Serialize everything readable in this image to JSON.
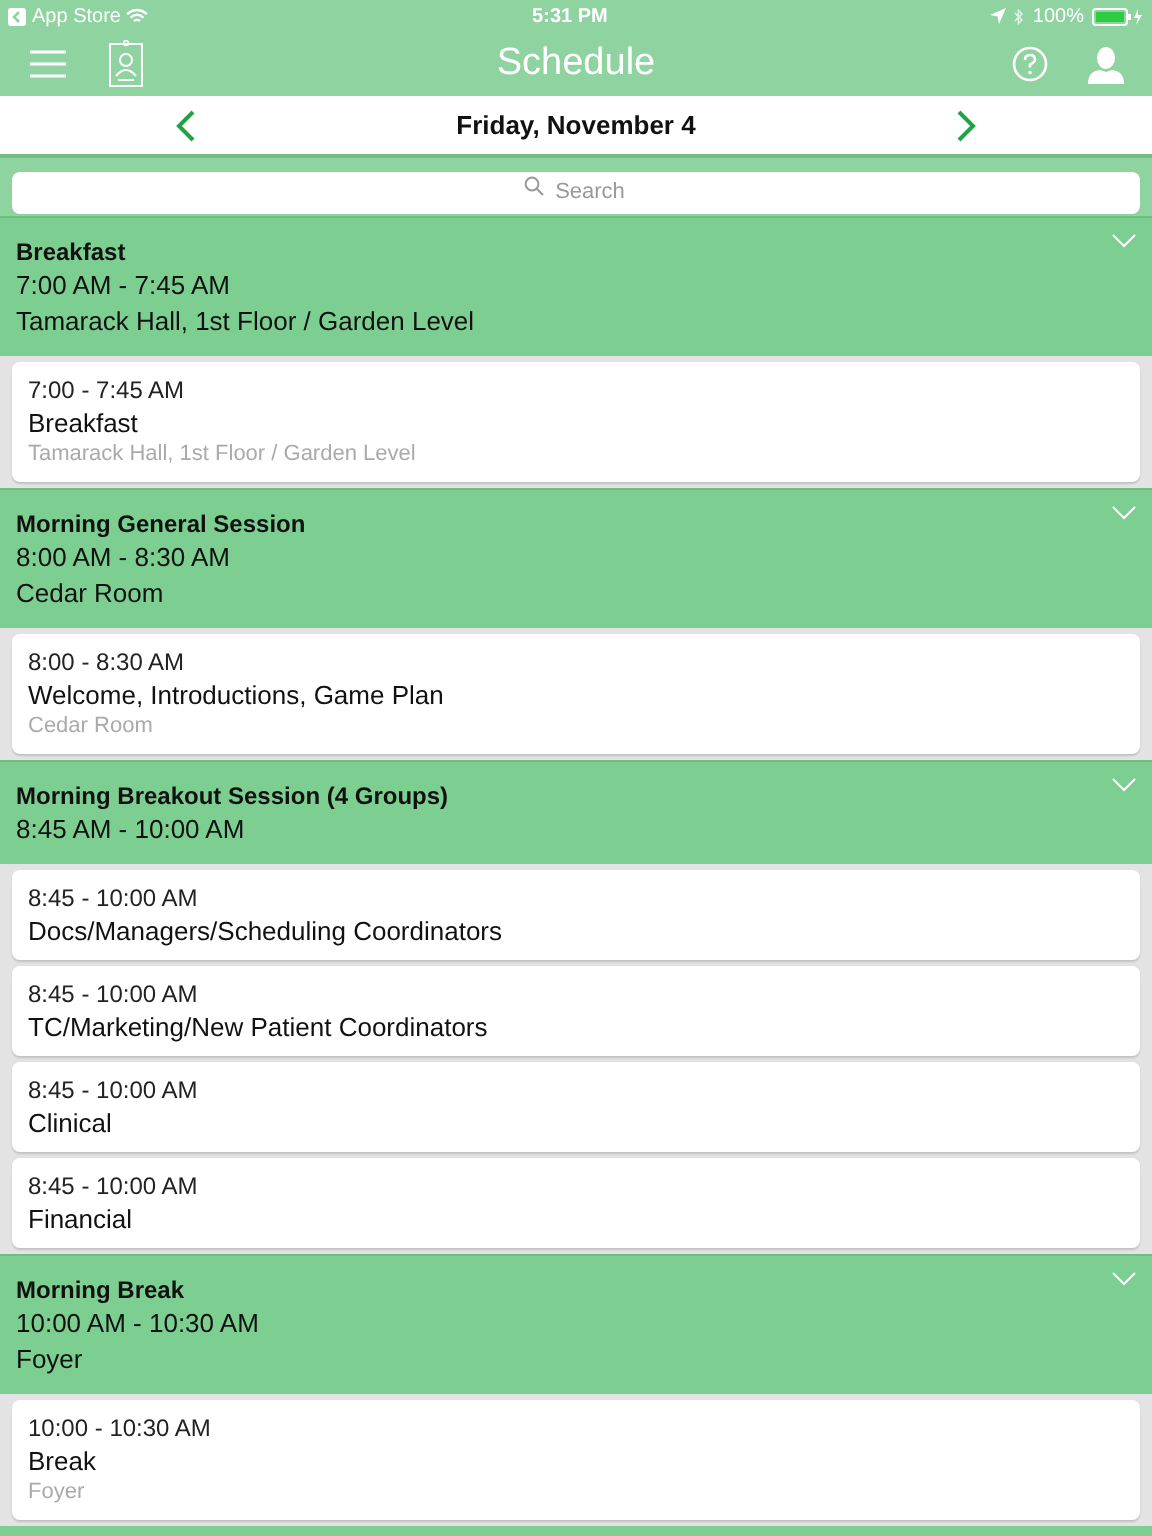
{
  "status_bar": {
    "back_label": "App Store",
    "time": "5:31 PM",
    "battery": "100%"
  },
  "nav": {
    "title": "Schedule"
  },
  "date_bar": {
    "date": "Friday, November 4"
  },
  "search": {
    "placeholder": "Search"
  },
  "sections": [
    {
      "title": "Breakfast",
      "time": "7:00 AM - 7:45 AM",
      "location": "Tamarack Hall, 1st Floor / Garden Level",
      "items": [
        {
          "time": "7:00 - 7:45 AM",
          "title": "Breakfast",
          "location": "Tamarack Hall, 1st Floor / Garden Level"
        }
      ]
    },
    {
      "title": "Morning General Session",
      "time": "8:00 AM - 8:30 AM",
      "location": "Cedar Room",
      "items": [
        {
          "time": "8:00 - 8:30 AM",
          "title": "Welcome, Introductions, Game Plan",
          "location": "Cedar Room"
        }
      ]
    },
    {
      "title": "Morning Breakout Session (4 Groups)",
      "time": "8:45 AM - 10:00 AM",
      "items": [
        {
          "time": "8:45 - 10:00 AM",
          "title": "Docs/Managers/Scheduling Coordinators"
        },
        {
          "time": "8:45 - 10:00 AM",
          "title": "TC/Marketing/New Patient Coordinators"
        },
        {
          "time": "8:45 - 10:00 AM",
          "title": "Clinical"
        },
        {
          "time": "8:45 - 10:00 AM",
          "title": "Financial"
        }
      ]
    },
    {
      "title": "Morning Break",
      "time": "10:00 AM - 10:30 AM",
      "location": "Foyer",
      "items": [
        {
          "time": "10:00 - 10:30 AM",
          "title": "Break",
          "location": "Foyer"
        }
      ]
    }
  ]
}
